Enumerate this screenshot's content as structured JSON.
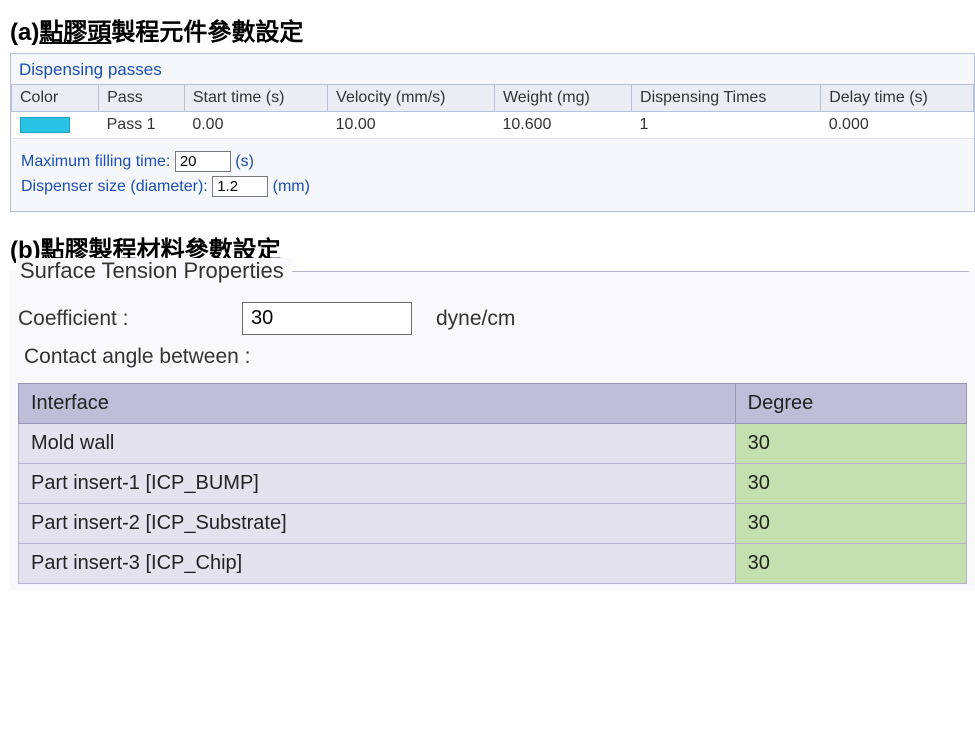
{
  "captions": {
    "a_prefix": "(a)",
    "a_underlined": "點膠頭",
    "a_rest": "製程元件參數設定",
    "b_prefix": "(b)",
    "b_underlined": "點膠製程",
    "b_rest": "材料參數設定"
  },
  "panel_a": {
    "title": "Dispensing passes",
    "headers": [
      "Color",
      "Pass",
      "Start time (s)",
      "Velocity (mm/s)",
      "Weight (mg)",
      "Dispensing Times",
      "Delay time (s)"
    ],
    "row": {
      "pass": "Pass 1",
      "start_time": "0.00",
      "velocity": "10.00",
      "weight": "10.600",
      "dispensing_times": "1",
      "delay_time": "0.000"
    },
    "max_fill_label": "Maximum filling time:",
    "max_fill_value": "20",
    "max_fill_unit": "(s)",
    "disp_size_label": "Dispenser size (diameter):",
    "disp_size_value": "1.2",
    "disp_size_unit": "(mm)"
  },
  "panel_b": {
    "group_title": "Surface Tension Properties",
    "coeff_label": "Coefficient :",
    "coeff_value": "30",
    "coeff_unit": "dyne/cm",
    "contact_angle_label": "Contact angle between :",
    "headers": [
      "Interface",
      "Degree"
    ],
    "rows": [
      {
        "interface": "Mold wall",
        "degree": "30"
      },
      {
        "interface": "Part insert-1 [ICP_BUMP]",
        "degree": "30"
      },
      {
        "interface": "Part insert-2 [ICP_Substrate]",
        "degree": "30"
      },
      {
        "interface": "Part insert-3 [ICP_Chip]",
        "degree": "30"
      }
    ]
  }
}
